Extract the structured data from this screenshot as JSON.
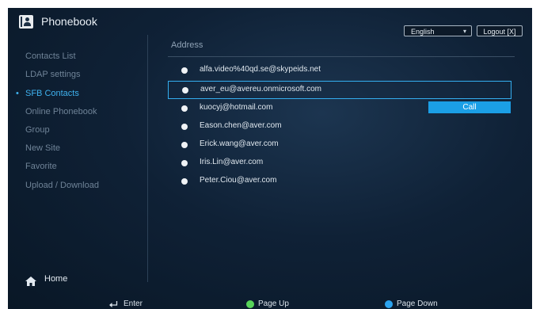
{
  "header": {
    "title": "Phonebook",
    "language": "English",
    "logout_label": "Logout [X]"
  },
  "sidebar": {
    "items": [
      {
        "label": "Contacts List"
      },
      {
        "label": "LDAP settings"
      },
      {
        "label": "SFB Contacts",
        "active": true
      },
      {
        "label": "Online Phonebook"
      },
      {
        "label": "Group"
      },
      {
        "label": "New Site"
      },
      {
        "label": "Favorite"
      },
      {
        "label": "Upload / Download"
      }
    ],
    "home_label": "Home"
  },
  "main": {
    "column_header": "Address",
    "contacts": [
      {
        "address": "alfa.video%40qd.se@skypeids.net"
      },
      {
        "address": "aver_eu@avereu.onmicrosoft.com",
        "selected": true
      },
      {
        "address": "kuocyj@hotmail.com"
      },
      {
        "address": "Eason.chen@aver.com"
      },
      {
        "address": "Erick.wang@aver.com"
      },
      {
        "address": "Iris.Lin@aver.com"
      },
      {
        "address": "Peter.Ciou@aver.com"
      }
    ],
    "call_label": "Call"
  },
  "footer": {
    "enter_label": "Enter",
    "page_up_label": "Page Up",
    "page_down_label": "Page Down"
  },
  "colors": {
    "accent": "#34aef0",
    "page_up": "#58d45a",
    "page_down": "#2ba3ef"
  }
}
